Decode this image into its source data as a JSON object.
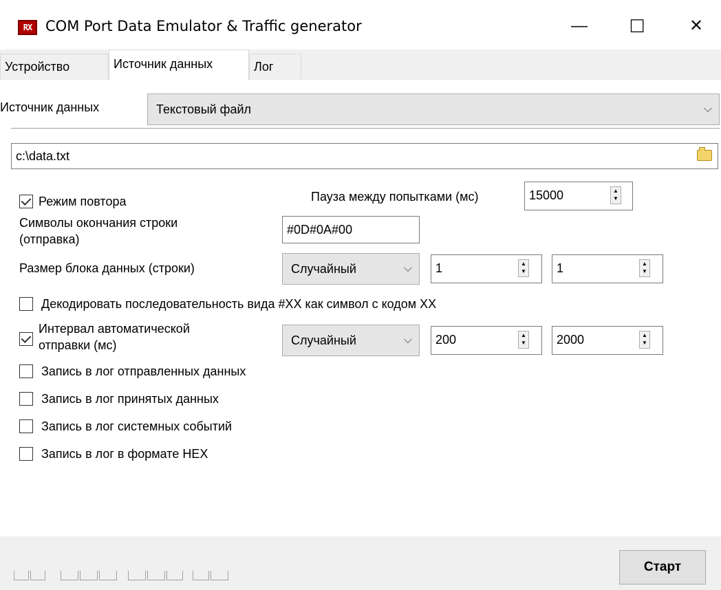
{
  "window": {
    "title": "COM Port Data Emulator & Traffic generator",
    "icon_text": "RX",
    "minimize": "—",
    "maximize": "☐",
    "close": "✕"
  },
  "tabs": [
    {
      "label": "Устройство",
      "active": false
    },
    {
      "label": "Источник данных",
      "active": true
    },
    {
      "label": "Лог",
      "active": false
    }
  ],
  "source": {
    "label": "Источник данных",
    "selected": "Текстовый файл"
  },
  "file_path": {
    "value": "c:\\data.txt",
    "browse_icon": "folder-open-icon"
  },
  "repeat_mode": {
    "label": "Режим повтора",
    "checked": true
  },
  "pause": {
    "label": "Пауза между попытками (мс)",
    "value": "15000"
  },
  "line_end": {
    "label_line1": "Символы окончания строки",
    "label_line2": "(отправка)",
    "value": "#0D#0A#00"
  },
  "block_size": {
    "label": "Размер блока данных (строки)",
    "mode": "Случайный",
    "min": "1",
    "max": "1"
  },
  "decode": {
    "label": "Декодировать последовательность вида #XX как символ с кодом XX",
    "checked": false
  },
  "auto_interval": {
    "label_line1": "Интервал автоматической",
    "label_line2": "отправки (мс)",
    "checked": true,
    "mode": "Случайный",
    "min": "200",
    "max": "2000"
  },
  "log_options": [
    {
      "label": "Запись в лог отправленных данных",
      "checked": false
    },
    {
      "label": "Запись в лог принятых данных",
      "checked": false
    },
    {
      "label": "Запись в лог системных событий",
      "checked": false
    },
    {
      "label": "Запись в лог в формате HEX",
      "checked": false
    }
  ],
  "start_button": "Старт",
  "colors": {
    "window_bg": "#f0f0f0",
    "panel_bg": "#ffffff",
    "icon_red": "#b00000"
  }
}
